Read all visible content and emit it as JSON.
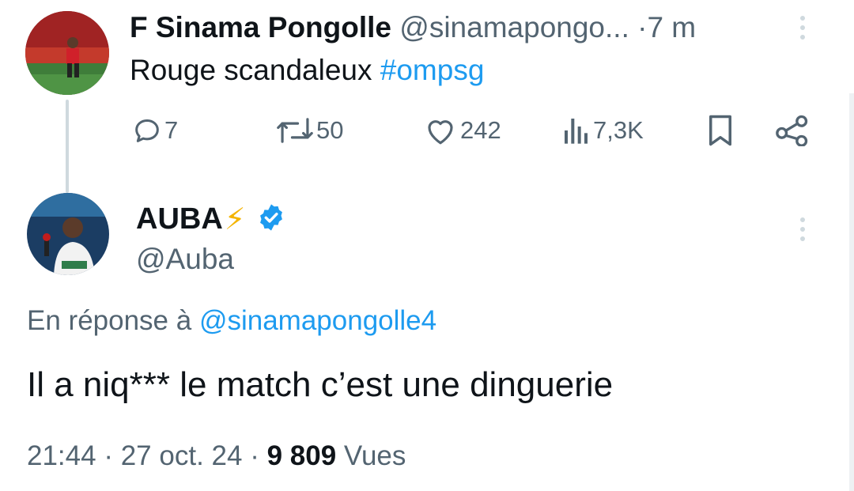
{
  "parent_tweet": {
    "display_name": "F Sinama Pongolle",
    "handle": "@sinamapongo...",
    "separator": "·",
    "time": "7 m",
    "text_before": "Rouge scandaleux ",
    "hashtag": "#ompsg",
    "actions": {
      "replies": "7",
      "retweets": "50",
      "likes": "242",
      "views": "7,3K"
    }
  },
  "reply_tweet": {
    "display_name": "AUBA",
    "name_emoji": "⚡",
    "handle": "@Auba",
    "reply_prefix": "En réponse à ",
    "reply_mention": "@sinamapongolle4",
    "text": "Il a niq*** le match c’est une dinguerie",
    "time": "21:44",
    "date": "27 oct. 24",
    "views_count": "9 809",
    "views_label": "Vues"
  },
  "colors": {
    "link": "#1d9bf0",
    "secondary_text": "#536471",
    "primary_text": "#0f1419",
    "verified": "#1d9bf0",
    "thread_line": "#cfd9de"
  },
  "icons": [
    "reply-icon",
    "retweet-icon",
    "like-icon",
    "views-icon",
    "bookmark-icon",
    "share-icon",
    "more-icon",
    "verified-badge-icon"
  ]
}
